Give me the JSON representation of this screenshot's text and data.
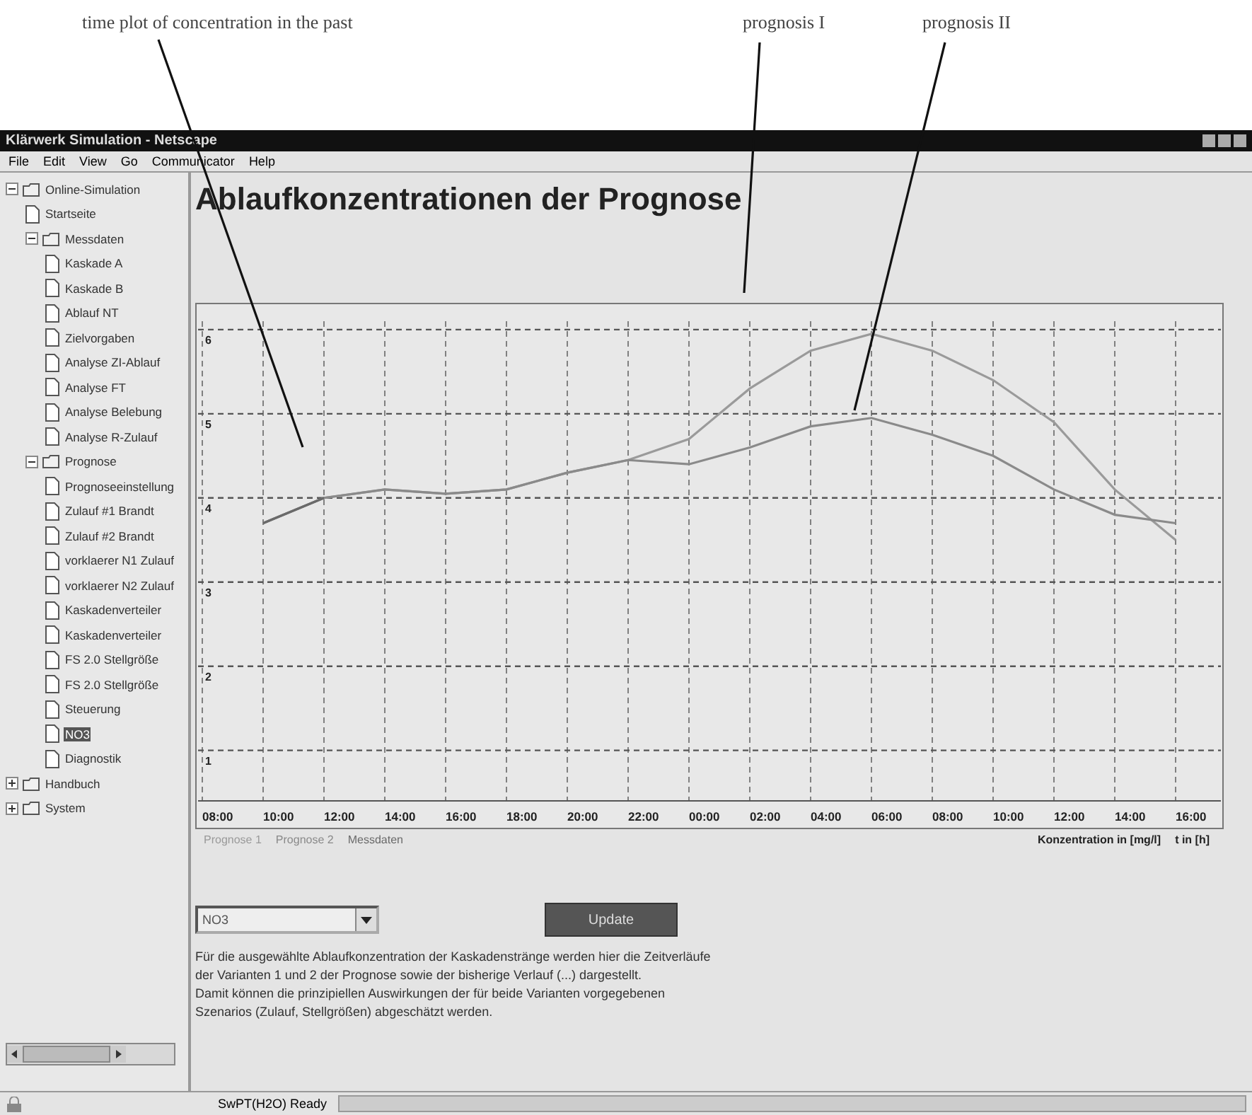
{
  "annotations": [
    {
      "text": "time plot of concentration in the past"
    },
    {
      "text": "prognosis I"
    },
    {
      "text": "prognosis II"
    }
  ],
  "window": {
    "title": "Klärwerk Simulation - Netscape"
  },
  "menu": [
    "File",
    "Edit",
    "View",
    "Go",
    "Communicator",
    "Help"
  ],
  "sidebar": {
    "items": [
      {
        "label": "Online-Simulation",
        "expanded": true,
        "selected": false,
        "children": [
          {
            "label": "Startseite",
            "selected": false
          },
          {
            "label": "Messdaten",
            "expanded": true,
            "selected": false,
            "children": [
              {
                "label": "Kaskade A",
                "selected": false
              },
              {
                "label": "Kaskade B",
                "selected": false
              },
              {
                "label": "Ablauf NT",
                "selected": false
              },
              {
                "label": "Zielvorgaben",
                "selected": false
              },
              {
                "label": "Analyse ZI-Ablauf",
                "selected": false
              },
              {
                "label": "Analyse FT",
                "selected": false
              },
              {
                "label": "Analyse Belebung",
                "selected": false
              },
              {
                "label": "Analyse R-Zulauf",
                "selected": false
              }
            ]
          },
          {
            "label": "Prognose",
            "expanded": true,
            "selected": false,
            "children": [
              {
                "label": "Prognoseeinstellung",
                "selected": false
              },
              {
                "label": "Zulauf #1 Brandt",
                "selected": false
              },
              {
                "label": "Zulauf #2 Brandt",
                "selected": false
              },
              {
                "label": "vorklaerer N1 Zulauf",
                "selected": false
              },
              {
                "label": "vorklaerer N2 Zulauf",
                "selected": false
              },
              {
                "label": "Kaskadenverteiler",
                "selected": false
              },
              {
                "label": "Kaskadenverteiler",
                "selected": false
              },
              {
                "label": "FS 2.0 Stellgröße",
                "selected": false
              },
              {
                "label": "FS 2.0 Stellgröße",
                "selected": false
              },
              {
                "label": "Steuerung",
                "selected": false
              },
              {
                "label": "NO3",
                "selected": true
              },
              {
                "label": "Diagnostik",
                "selected": false
              }
            ]
          }
        ]
      },
      {
        "label": "Handbuch",
        "expanded": false,
        "selected": false
      },
      {
        "label": "System",
        "expanded": false,
        "selected": false
      }
    ]
  },
  "page": {
    "title": "Ablaufkonzentrationen der Prognose",
    "chart_data": {
      "type": "line",
      "grid": true,
      "categories": [
        "08:00",
        "10:00",
        "12:00",
        "14:00",
        "16:00",
        "18:00",
        "20:00",
        "22:00",
        "00:00",
        "02:00",
        "04:00",
        "06:00",
        "08:00",
        "10:00",
        "12:00",
        "14:00",
        "16:00"
      ],
      "ylim": [
        0.4,
        6.1
      ],
      "yticks": [
        1,
        2,
        3,
        4,
        5,
        6
      ],
      "series": [
        {
          "name": "Prognose 1",
          "color": "#9a9a9a",
          "values": [
            null,
            3.7,
            4.0,
            4.1,
            4.05,
            4.1,
            4.3,
            4.45,
            4.7,
            5.3,
            5.75,
            5.95,
            5.75,
            5.4,
            4.9,
            4.1,
            3.5
          ]
        },
        {
          "name": "Prognose 2",
          "color": "#8a8a8a",
          "values": [
            null,
            3.7,
            4.0,
            4.1,
            4.05,
            4.1,
            4.3,
            4.45,
            4.4,
            4.6,
            4.85,
            4.95,
            4.75,
            4.5,
            4.1,
            3.8,
            3.7
          ]
        },
        {
          "name": "Messdaten",
          "color": "#6a6a6a",
          "values": [
            null,
            3.7,
            4.0,
            null,
            null,
            null,
            null,
            null,
            null,
            null,
            null,
            null,
            null,
            null,
            null,
            null,
            null
          ]
        }
      ]
    },
    "ylabel": "Konzentration in [mg/l]",
    "xlabel": "t in [h]",
    "select": {
      "value": "NO3"
    },
    "button": "Update",
    "text": [
      "Für die ausgewählte Ablaufkonzentration der Kaskadenstränge werden hier die Zeitverläufe",
      "der Varianten 1 und 2 der Prognose sowie der bisherige Verlauf (...) dargestellt.",
      "Damit können die prinzipiellen Auswirkungen der für beide Varianten vorgegebenen",
      "Szenarios (Zulauf, Stellgrößen) abgeschätzt werden."
    ]
  },
  "status_bar": {
    "text": "SwPT(H2O) Ready"
  }
}
